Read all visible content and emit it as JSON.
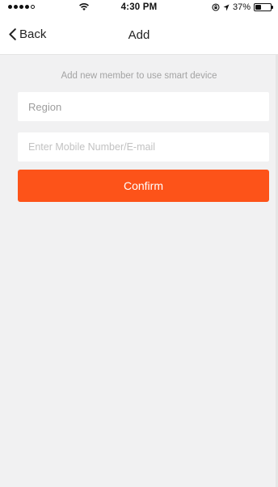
{
  "status_bar": {
    "time": "4:30 PM",
    "battery_text": "37%",
    "battery_level": 0.37,
    "signal_bars_filled": 4,
    "signal_bars_total": 5,
    "icons": [
      "signal-dots-icon",
      "wifi-icon",
      "rotation-lock-icon",
      "location-arrow-icon",
      "battery-icon"
    ]
  },
  "nav": {
    "back_label": "Back",
    "title": "Add"
  },
  "form": {
    "hint": "Add new member to use smart device",
    "region_label": "Region",
    "contact_placeholder": "Enter Mobile Number/E-mail",
    "contact_value": "",
    "confirm_label": "Confirm"
  },
  "colors": {
    "accent": "#fd5319",
    "background": "#f1f1f2",
    "hint_text": "#a3a3a3"
  }
}
